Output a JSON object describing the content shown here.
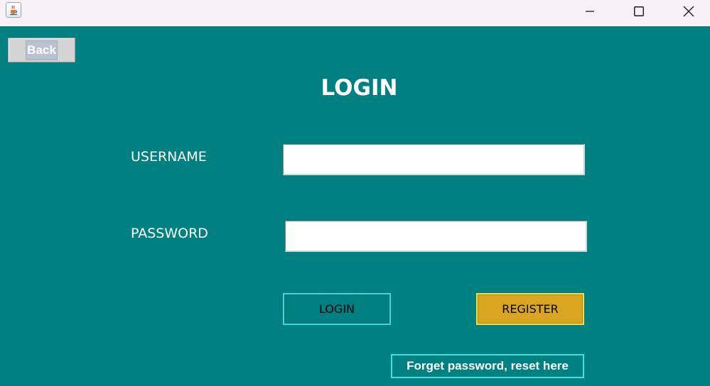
{
  "window": {
    "icon": "java-cup-icon",
    "controls": {
      "minimize": "minimize-icon",
      "maximize": "maximize-icon",
      "close": "close-icon"
    }
  },
  "back_button": {
    "label": "Back"
  },
  "title": "LOGIN",
  "form": {
    "username_label": "USERNAME",
    "username_value": "",
    "password_label": "PASSWORD",
    "password_value": ""
  },
  "buttons": {
    "login": "LOGIN",
    "register": "REGISTER",
    "forget": "Forget password, reset here"
  },
  "colors": {
    "background": "#008080",
    "register_button": "#DAA520",
    "button_border": "#40E0E0",
    "text": "#FFFFFF"
  }
}
